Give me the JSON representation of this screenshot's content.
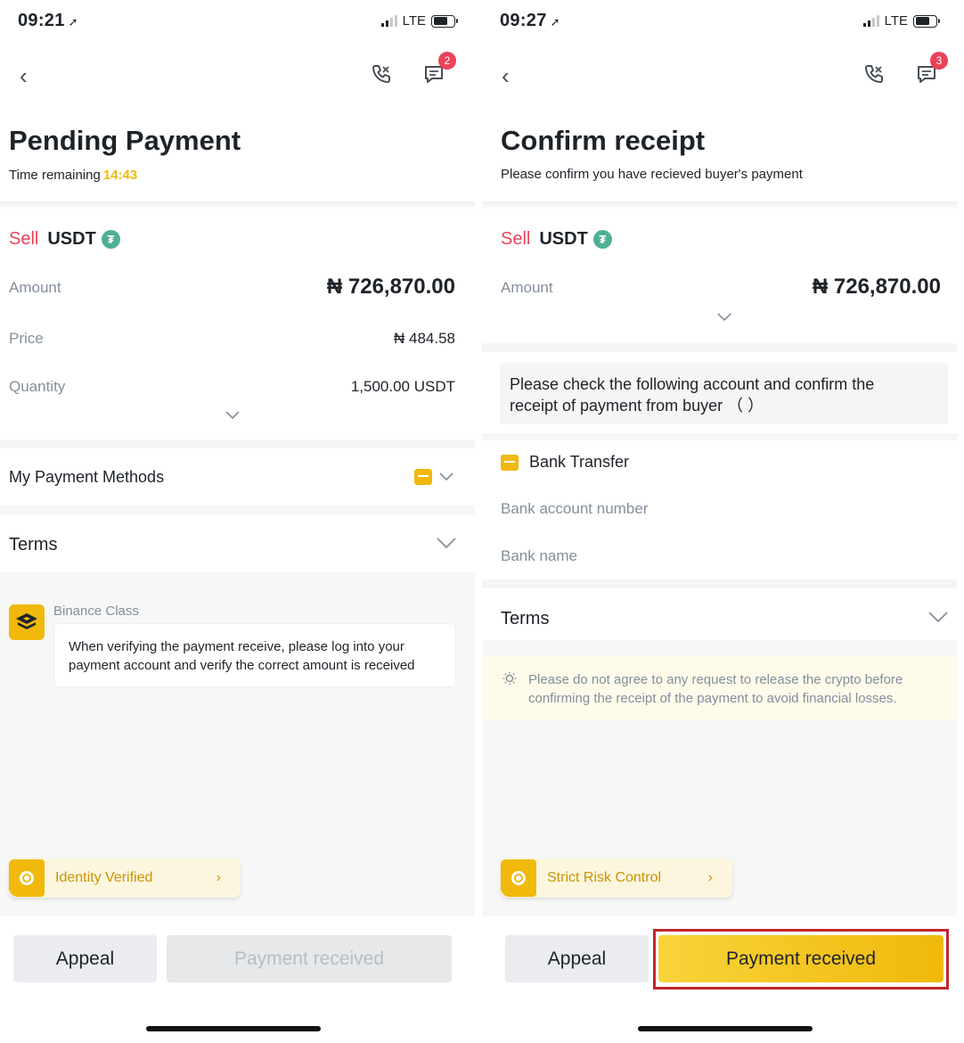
{
  "left": {
    "status": {
      "time": "09:21",
      "network": "LTE"
    },
    "nav": {
      "back_icon": "chevron-left",
      "call_icon": "phone",
      "chat_icon": "chat",
      "chat_badge": "2"
    },
    "title": "Pending Payment",
    "subtitle": "Time remaining",
    "timer": "14:43",
    "order": {
      "side": "Sell",
      "asset": "USDT",
      "amount_label": "Amount",
      "amount_value": "₦ 726,870.00",
      "price_label": "Price",
      "price_value": "₦ 484.58",
      "quantity_label": "Quantity",
      "quantity_value": "1,500.00 USDT"
    },
    "payment_methods_label": "My Payment Methods",
    "terms_label": "Terms",
    "binance_class": {
      "name": "Binance Class",
      "message": "When verifying the payment receive, please log into your payment account and verify the correct amount is received"
    },
    "badge_label": "Identity Verified",
    "buttons": {
      "appeal": "Appeal",
      "payment_received": "Payment received"
    }
  },
  "right": {
    "status": {
      "time": "09:27",
      "network": "LTE"
    },
    "nav": {
      "back_icon": "chevron-left",
      "call_icon": "phone",
      "chat_icon": "chat",
      "chat_badge": "3"
    },
    "title": "Confirm receipt",
    "subtitle": "Please confirm you have recieved buyer's payment",
    "order": {
      "side": "Sell",
      "asset": "USDT",
      "amount_label": "Amount",
      "amount_value": "₦ 726,870.00"
    },
    "notice_line1": "Please check the following account and confirm the",
    "notice_line2": "receipt of payment from buyer （                  ）",
    "payment_method": "Bank Transfer",
    "bank_account_label": "Bank account number",
    "bank_name_label": "Bank name",
    "terms_label": "Terms",
    "warning": "Please do not agree to any request to release the crypto before confirming the receipt of the payment to avoid financial losses.",
    "badge_label": "Strict Risk Control",
    "buttons": {
      "appeal": "Appeal",
      "payment_received": "Payment received"
    }
  },
  "colors": {
    "sell": "#e94359",
    "accent": "#f0b90b",
    "highlight_border": "#c0272d",
    "tether": "#50af95"
  }
}
